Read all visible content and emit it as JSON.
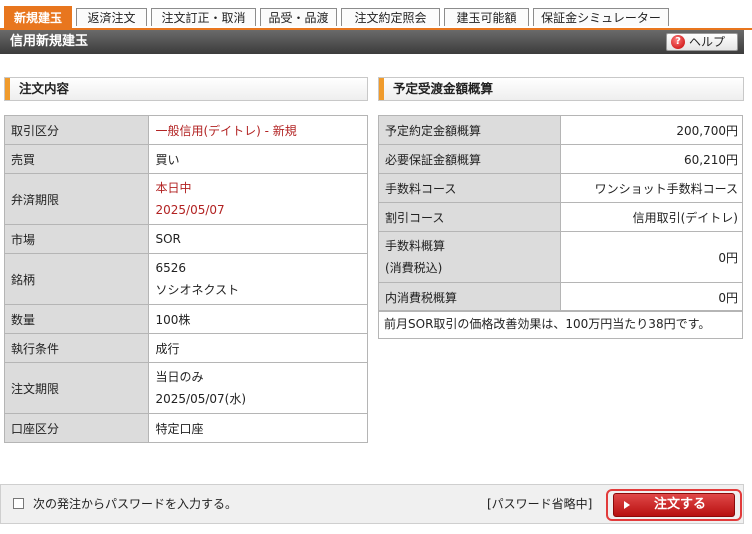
{
  "tabs": [
    {
      "label": "新規建玉",
      "active": true
    },
    {
      "label": "返済注文",
      "active": false
    },
    {
      "label": "注文訂正・取消",
      "active": false
    },
    {
      "label": "品受・品渡",
      "active": false
    },
    {
      "label": "注文約定照会",
      "active": false
    },
    {
      "label": "建玉可能額",
      "active": false
    },
    {
      "label": "保証金シミュレーター",
      "active": false
    }
  ],
  "header": {
    "title": "信用新規建玉",
    "help_label": "ヘルプ"
  },
  "order": {
    "section_title": "注文内容",
    "rows": [
      {
        "label": "取引区分",
        "lines": [
          "一般信用(デイトレ) - 新規"
        ],
        "accent": "red"
      },
      {
        "label": "売買",
        "lines": [
          "買い"
        ]
      },
      {
        "label": "弁済期限",
        "lines": [
          "本日中",
          "2025/05/07"
        ],
        "accent": "red"
      },
      {
        "label": "市場",
        "lines": [
          "SOR"
        ]
      },
      {
        "label": "銘柄",
        "lines": [
          "6526",
          "ソシオネクスト"
        ]
      },
      {
        "label": "数量",
        "lines": [
          "100株"
        ]
      },
      {
        "label": "執行条件",
        "lines": [
          "成行"
        ]
      },
      {
        "label": "注文期限",
        "lines": [
          "当日のみ",
          "2025/05/07(水)"
        ]
      },
      {
        "label": "口座区分",
        "lines": [
          "特定口座"
        ]
      }
    ]
  },
  "estimate": {
    "section_title": "予定受渡金額概算",
    "rows": [
      {
        "label": [
          "予定約定金額概算"
        ],
        "value": "200,700円"
      },
      {
        "label": [
          "必要保証金額概算"
        ],
        "value": "60,210円"
      },
      {
        "label": [
          "手数料コース"
        ],
        "value": "ワンショット手数料コース"
      },
      {
        "label": [
          "割引コース"
        ],
        "value": "信用取引(デイトレ)"
      },
      {
        "label": [
          "手数料概算",
          "(消費税込)"
        ],
        "value": "0円"
      },
      {
        "label": [
          "内消費税概算"
        ],
        "value": "0円"
      }
    ],
    "note": "前月SOR取引の価格改善効果は、100万円当たり38円です。"
  },
  "footer": {
    "checkbox_label": "次の発注からパスワードを入力する。",
    "checkbox_checked": false,
    "password_status": "[パスワード省略中]",
    "submit_label": "注文する"
  },
  "colors": {
    "accent": "#e8761e",
    "submit": "#c81818",
    "label_bg": "#dcdcdc",
    "red_text": "#b22222"
  }
}
